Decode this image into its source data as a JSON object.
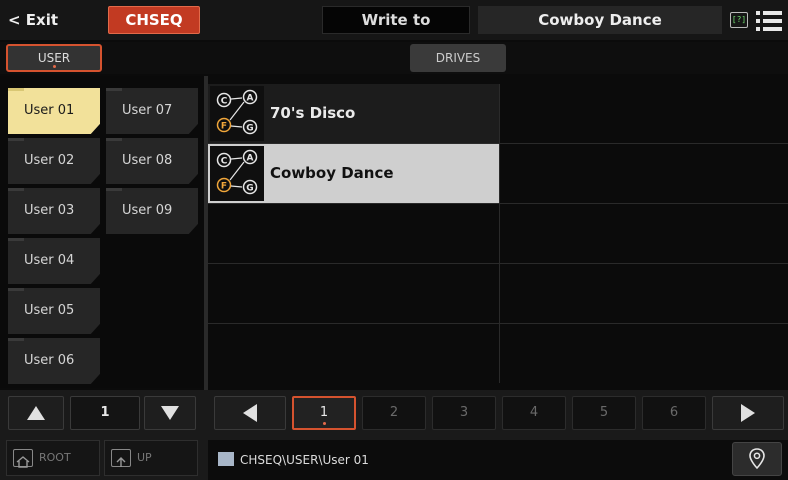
{
  "topbar": {
    "exit_label": "< Exit",
    "mode_label": "CHSEQ",
    "write_to_label": "Write to",
    "current_name": "Cowboy Dance",
    "help_label": "[?]",
    "help_icon": "help-icon",
    "menu_icon": "menu-list-icon"
  },
  "tabs": {
    "user_label": "USER",
    "drives_label": "DRIVES"
  },
  "folders": [
    {
      "label": "User 01",
      "selected": true
    },
    {
      "label": "User 07",
      "selected": false
    },
    {
      "label": "User 02",
      "selected": false
    },
    {
      "label": "User 08",
      "selected": false
    },
    {
      "label": "User 03",
      "selected": false
    },
    {
      "label": "User 09",
      "selected": false
    },
    {
      "label": "User 04",
      "selected": false
    },
    {
      "label": "User 05",
      "selected": false
    },
    {
      "label": "User 06",
      "selected": false
    }
  ],
  "files": [
    {
      "name": "70's Disco",
      "icon": "chord-sequence-icon",
      "selected": false
    },
    {
      "name": "Cowboy Dance",
      "icon": "chord-sequence-icon",
      "selected": true
    }
  ],
  "chord_icon_letters": [
    "C",
    "A",
    "F",
    "G"
  ],
  "folder_pager": {
    "page": "1"
  },
  "file_pager": {
    "pages": [
      "1",
      "2",
      "3",
      "4",
      "5",
      "6"
    ],
    "active_page": "1"
  },
  "utility": {
    "root_label": "ROOT",
    "up_label": "UP"
  },
  "path": "CHSEQ\\USER\\User 01",
  "colors": {
    "accent": "#d5532f",
    "mode_button": "#c23a22",
    "selected_folder": "#f2e19a",
    "selected_file": "#cfcfcf"
  }
}
